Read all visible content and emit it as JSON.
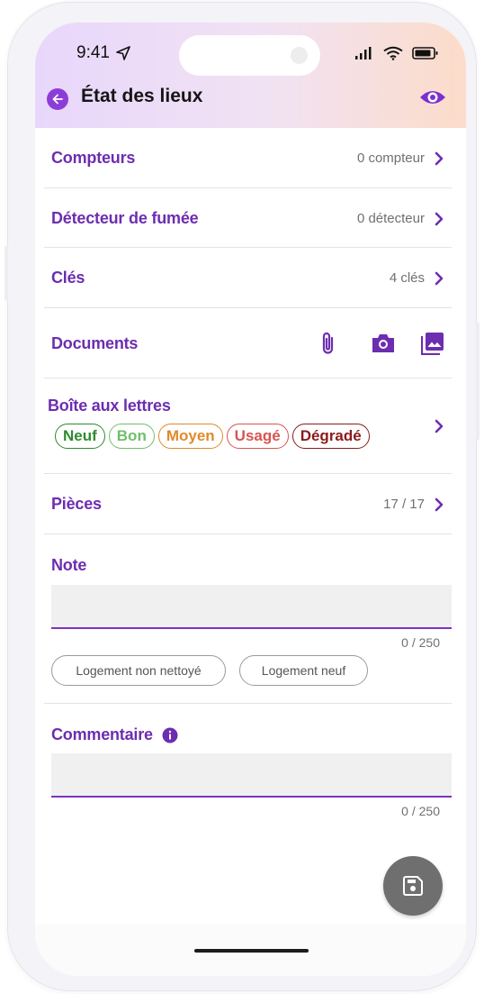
{
  "status_bar": {
    "time": "9:41"
  },
  "header": {
    "title": "État des lieux"
  },
  "rows": {
    "compteurs": {
      "label": "Compteurs",
      "value": "0 compteur"
    },
    "detecteur": {
      "label": "Détecteur de fumée",
      "value": "0 détecteur"
    },
    "cles": {
      "label": "Clés",
      "value": "4 clés"
    },
    "documents": {
      "label": "Documents",
      "actions": [
        "paperclip-icon",
        "camera-icon",
        "image-icon"
      ]
    },
    "boite": {
      "label": "Boîte aux lettres",
      "states": [
        {
          "label": "Neuf",
          "color": "#2e8b2e"
        },
        {
          "label": "Bon",
          "color": "#6fbf6a"
        },
        {
          "label": "Moyen",
          "color": "#e08a2a"
        },
        {
          "label": "Usagé",
          "color": "#d9534f"
        },
        {
          "label": "Dégradé",
          "color": "#8b1a1a"
        }
      ]
    },
    "pieces": {
      "label": "Pièces",
      "value": "17 / 17"
    }
  },
  "note": {
    "label": "Note",
    "value": "",
    "counter": "0 / 250",
    "suggestions": [
      "Logement non nettoyé",
      "Logement neuf"
    ]
  },
  "commentaire": {
    "label": "Commentaire",
    "value": "",
    "counter": "0 / 250"
  },
  "colors": {
    "accent": "#6d2db0",
    "back_button": "#8c3dd8",
    "fab": "#6f6f6f"
  }
}
